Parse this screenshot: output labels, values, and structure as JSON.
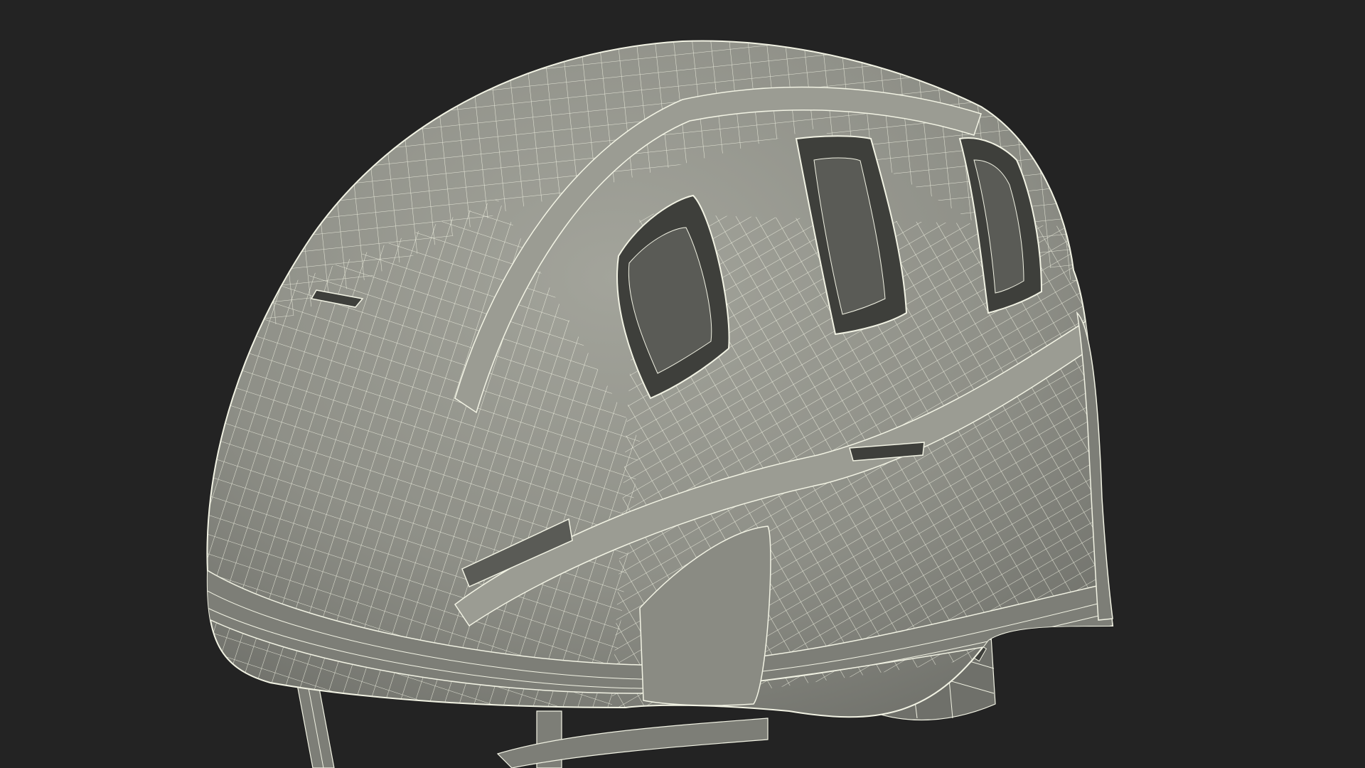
{
  "scene": {
    "background_color": "#232323",
    "shell_color": "#8e8f87",
    "shell_shadow_color": "#6f706a",
    "shell_light_color": "#a3a49b",
    "vent_color": "#3e3f3b",
    "vent_inner_color": "#5a5b56",
    "wire_color": "#f2f3e4",
    "strap_color": "#7d7e77",
    "object_icon": "helmet-icon"
  }
}
